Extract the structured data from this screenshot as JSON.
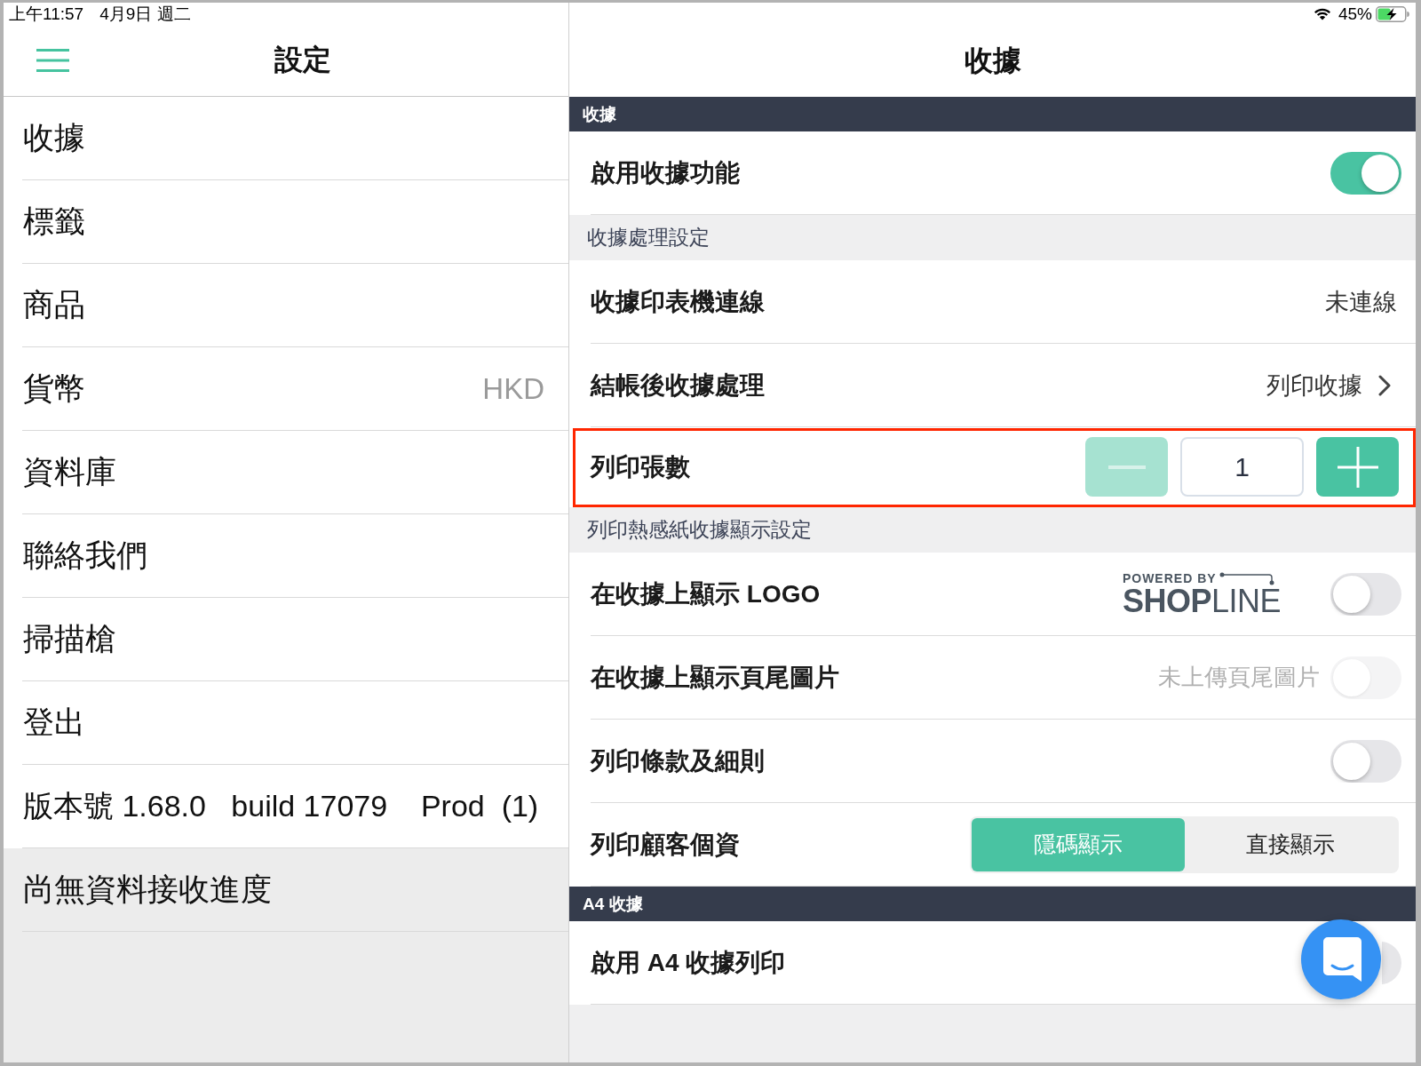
{
  "status_bar": {
    "time": "上午11:57",
    "date": "4月9日 週二",
    "battery": "45%"
  },
  "sidebar": {
    "title": "設定",
    "items": [
      {
        "kind": "link",
        "label": "收據"
      },
      {
        "kind": "link",
        "label": "標籤"
      },
      {
        "kind": "link",
        "label": "商品"
      },
      {
        "kind": "link",
        "label": "貨幣",
        "value": "HKD"
      },
      {
        "kind": "link",
        "label": "資料庫"
      },
      {
        "kind": "link",
        "label": "聯絡我們"
      },
      {
        "kind": "link",
        "label": "掃描槍"
      },
      {
        "kind": "link",
        "label": "登出"
      },
      {
        "kind": "version",
        "label": "版本號 1.68.0   build 17079    Prod  (1)"
      },
      {
        "kind": "info",
        "label": "尚無資料接收進度"
      }
    ]
  },
  "detail": {
    "title": "收據",
    "groups": [
      {
        "kind": "dark",
        "title": "收據",
        "rows": [
          {
            "kind": "toggle",
            "label": "啟用收據功能",
            "on": true,
            "disabled": false,
            "highlighted": false
          }
        ]
      },
      {
        "kind": "light",
        "title": "收據處理設定",
        "rows": [
          {
            "kind": "value",
            "label": "收據印表機連線",
            "value": "未連線",
            "highlighted": false
          },
          {
            "kind": "link",
            "label": "結帳後收據處理",
            "value": "列印收據",
            "highlighted": false
          },
          {
            "kind": "stepper",
            "label": "列印張數",
            "value": "1",
            "minus_disabled": true,
            "highlighted": true
          }
        ]
      },
      {
        "kind": "light",
        "title": "列印熱感紙收據顯示設定",
        "rows": [
          {
            "kind": "toggle",
            "label": "在收據上顯示 LOGO",
            "on": false,
            "disabled": false,
            "highlighted": false,
            "logo": {
              "tagline": "POWERED BY",
              "wordmark": "**SHOP**LINE"
            }
          },
          {
            "kind": "toggle",
            "label": "在收據上顯示頁尾圖片",
            "on": false,
            "disabled": true,
            "highlighted": false,
            "hint": "未上傳頁尾圖片"
          },
          {
            "kind": "toggle",
            "label": "列印條款及細則",
            "on": false,
            "disabled": false,
            "highlighted": false
          },
          {
            "kind": "segmented",
            "label": "列印顧客個資",
            "highlighted": false,
            "options": [
              {
                "label": "隱碼顯示",
                "selected": true
              },
              {
                "label": "直接顯示",
                "selected": false
              }
            ]
          }
        ]
      },
      {
        "kind": "dark",
        "title": "A4 收據",
        "rows": [
          {
            "kind": "toggle",
            "label": "啟用 A4 收據列印",
            "on": false,
            "disabled": false,
            "highlighted": false
          }
        ]
      }
    ]
  }
}
